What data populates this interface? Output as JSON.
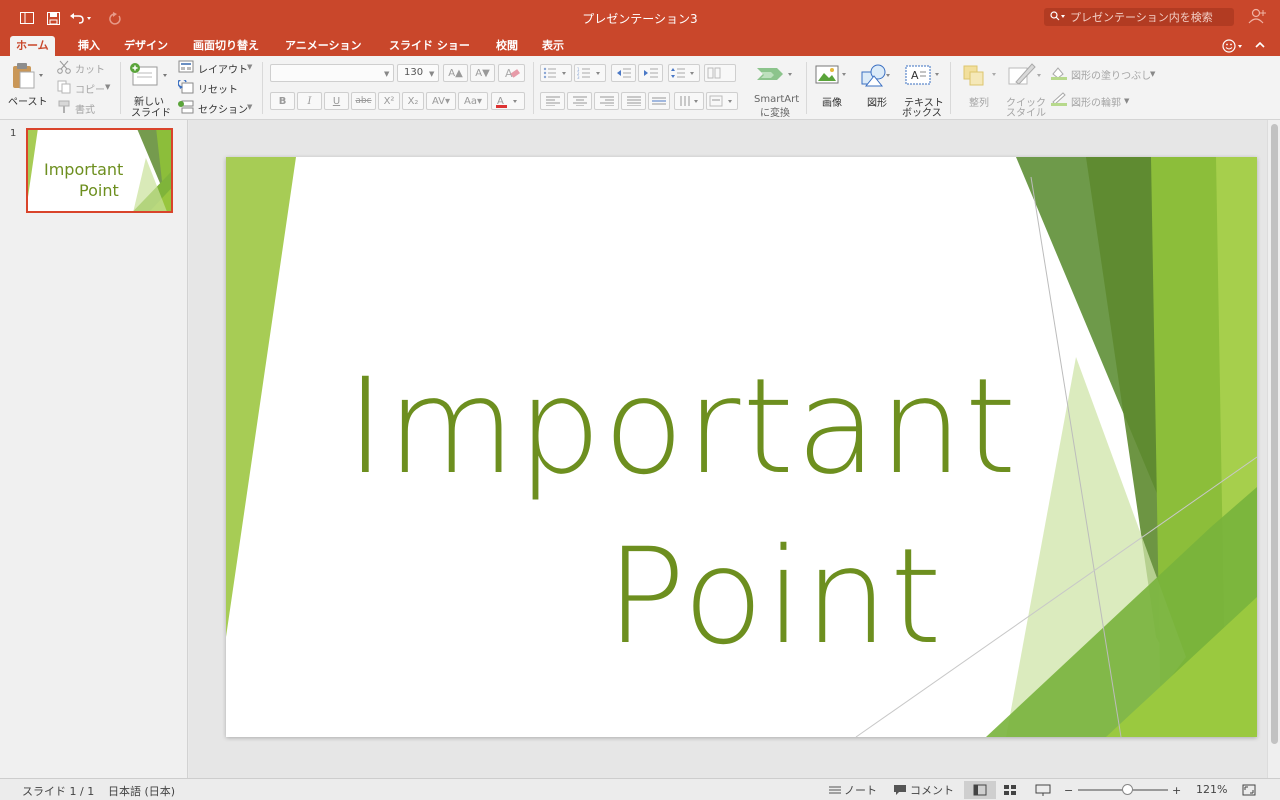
{
  "window": {
    "title": "プレゼンテーション3",
    "search_placeholder": "プレゼンテーション内を検索"
  },
  "tabs": [
    {
      "label": "ホーム",
      "active": true
    },
    {
      "label": "挿入"
    },
    {
      "label": "デザイン"
    },
    {
      "label": "画面切り替え"
    },
    {
      "label": "アニメーション"
    },
    {
      "label": "スライド ショー"
    },
    {
      "label": "校閲"
    },
    {
      "label": "表示"
    }
  ],
  "ribbon": {
    "paste": "ペースト",
    "cut": "カット",
    "copy": "コピー",
    "format": "書式",
    "new_slide_line1": "新しい",
    "new_slide_line2": "スライド",
    "layout": "レイアウト",
    "reset": "リセット",
    "section": "セクション",
    "font_size": "130",
    "smartart_line1": "SmartArt",
    "smartart_line2": "に変換",
    "picture": "画像",
    "shapes": "図形",
    "textbox_line1": "テキスト",
    "textbox_line2": "ボックス",
    "arrange": "整列",
    "quick_styles_line1": "クイック",
    "quick_styles_line2": "スタイル",
    "shape_fill": "図形の塗りつぶし",
    "shape_outline": "図形の輪郭",
    "bold": "B",
    "italic": "I",
    "underline": "U",
    "strike": "abc"
  },
  "thumbnails": [
    {
      "number": "1",
      "line1": "Important",
      "line2": "Point"
    }
  ],
  "slide": {
    "title_line1": "Important",
    "title_line2": "Point"
  },
  "status": {
    "slide_counter": "スライド 1 / 1",
    "language": "日本語 (日本)",
    "notes": "ノート",
    "comments": "コメント",
    "zoom": "121%",
    "zoom_level": 0.55
  },
  "colors": {
    "accent": "#c9472b",
    "title_green": "#6d8f1f",
    "shape_light": "#a7cc55",
    "shape_mid": "#85b93a",
    "shape_dark": "#5d8a2f"
  }
}
